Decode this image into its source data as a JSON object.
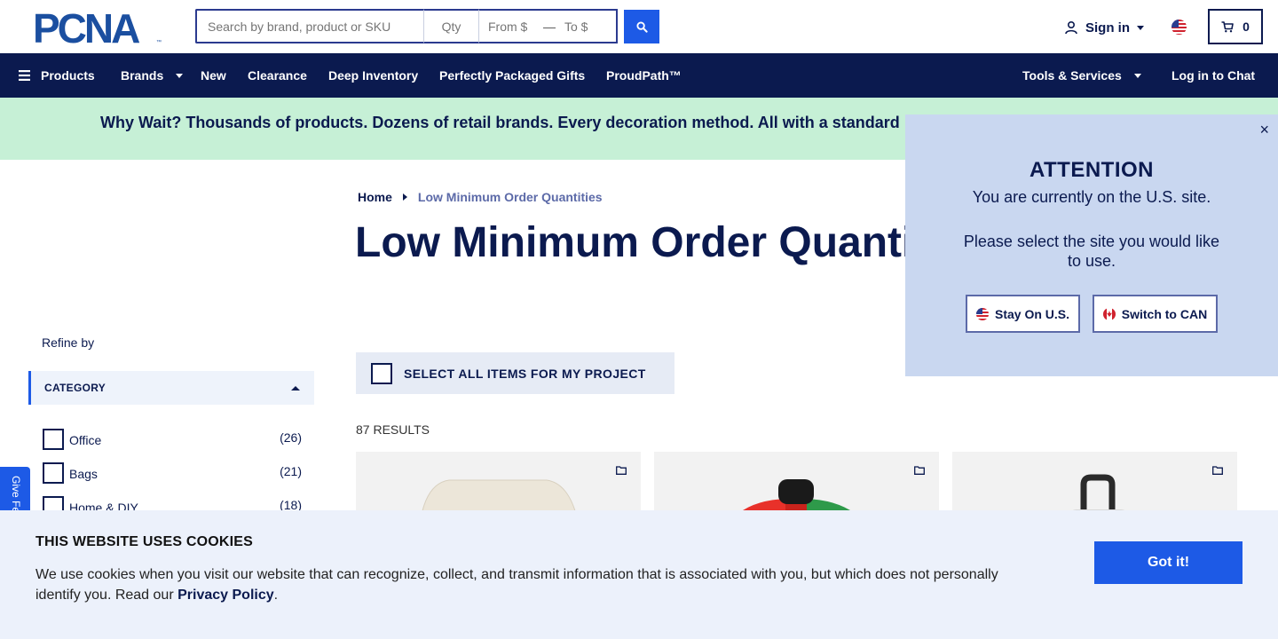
{
  "header": {
    "logo_text": "PCNA",
    "search_placeholder": "Search by brand, product or SKU",
    "qty_placeholder": "Qty",
    "price_from_placeholder": "From $",
    "price_to_placeholder": "To $",
    "signin_label": "Sign in",
    "cart_count": "0"
  },
  "nav": {
    "items": [
      {
        "label": "Products"
      },
      {
        "label": "Brands"
      },
      {
        "label": "New"
      },
      {
        "label": "Clearance"
      },
      {
        "label": "Deep Inventory"
      },
      {
        "label": "Perfectly Packaged Gifts"
      },
      {
        "label": "ProudPath™"
      }
    ],
    "tools_label": "Tools & Services",
    "chat_label": "Log in to Chat"
  },
  "promo": {
    "text": "Why Wait? Thousands of products. Dozens of retail brands. Every decoration method. All with a standard"
  },
  "breadcrumb": {
    "home": "Home",
    "current": "Low Minimum Order Quantities"
  },
  "page": {
    "title": "Low Minimum Order Quanti"
  },
  "sidebar": {
    "refine_label": "Refine by",
    "category_header": "CATEGORY",
    "categories": [
      {
        "label": "Office",
        "count": "(26)"
      },
      {
        "label": "Bags",
        "count": "(21)"
      },
      {
        "label": "Home & DIY",
        "count": "(18)"
      }
    ],
    "feedback_label": "Give Fe"
  },
  "results": {
    "select_all_label": "SELECT ALL ITEMS FOR MY PROJECT",
    "count_label": "87 RESULTS"
  },
  "attention": {
    "close": "×",
    "title": "ATTENTION",
    "line1": "You are currently on the U.S. site.",
    "line2": "Please select the site you would like to use.",
    "stay_label": "Stay On U.S.",
    "switch_label": "Switch to CAN"
  },
  "cookie": {
    "title": "THIS WEBSITE USES COOKIES",
    "text": "We use cookies when you visit our website that can recognize, collect, and transmit information that is associated with you, but which does not personally identify you. Read our",
    "link": "Privacy Policy",
    "period": ".",
    "button": "Got it!"
  },
  "colors": {
    "navy": "#0b1a4f",
    "brand_blue": "#1d5ae6",
    "promo_green": "#c6f0d6",
    "popup_blue": "#c9d7f0",
    "cookie_bg": "#ecf1fb"
  }
}
